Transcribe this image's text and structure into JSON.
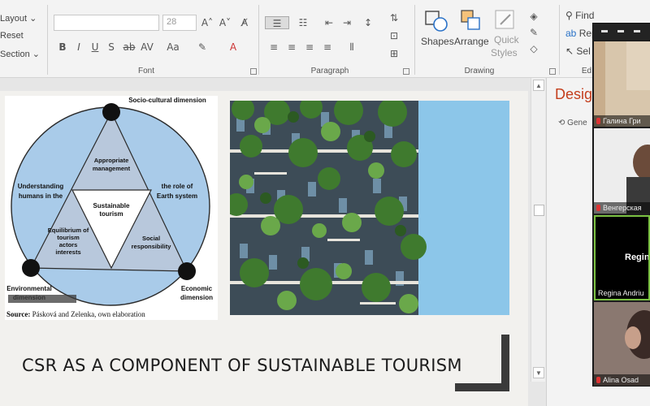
{
  "ribbon": {
    "slides_group": {
      "layout": "Layout",
      "reset": "Reset",
      "section": "Section"
    },
    "font_group": {
      "label": "Font",
      "size": "28",
      "font_box": ""
    },
    "paragraph_group": {
      "label": "Paragraph"
    },
    "drawing_group": {
      "label": "Drawing",
      "shapes": "Shapes",
      "arrange": "Arrange",
      "quick_styles_1": "Quick",
      "quick_styles_2": "Styles"
    },
    "editing_group": {
      "label": "Ed",
      "find": "Find",
      "replace": "Rep",
      "select": "Sel"
    }
  },
  "slide": {
    "title": "CSR AS A COMPONENT OF SUSTAINABLE TOURISM",
    "diagram": {
      "top_label": "Socio-cultural dimension",
      "left_label_1": "Understanding",
      "left_label_2": "humans in the",
      "right_label_1": "the role of",
      "right_label_2": "Earth system",
      "center_1": "Sustainable",
      "center_2": "tourism",
      "top_tri_1": "Appropriate",
      "top_tri_2": "management",
      "left_tri_1": "Equilibrium of",
      "left_tri_2": "tourism",
      "left_tri_3": "actors",
      "left_tri_4": "interests",
      "right_tri_1": "Social",
      "right_tri_2": "responsibility",
      "bottom_left_1": "Environmental",
      "bottom_left_2": "dimension",
      "bottom_right_1": "Economic",
      "bottom_right_2": "dimension",
      "source_bold": "Source:",
      "source_text": " Pásková and Zelenka, own elaboration"
    }
  },
  "design_pane": {
    "title": "Desig",
    "subtitle": "Gene"
  },
  "video_panel": {
    "participants": [
      {
        "name": "Галина Гри"
      },
      {
        "name": "Венгерская"
      },
      {
        "name": "Regina Andriu",
        "center_label": "Regin"
      },
      {
        "name": "Alina Osad"
      }
    ]
  },
  "colors": {
    "accent_red": "#c43e1c",
    "triangle_blue": "#b9c9de",
    "circle_blue": "#a8c8e8",
    "sky": "#8cc6e9"
  }
}
